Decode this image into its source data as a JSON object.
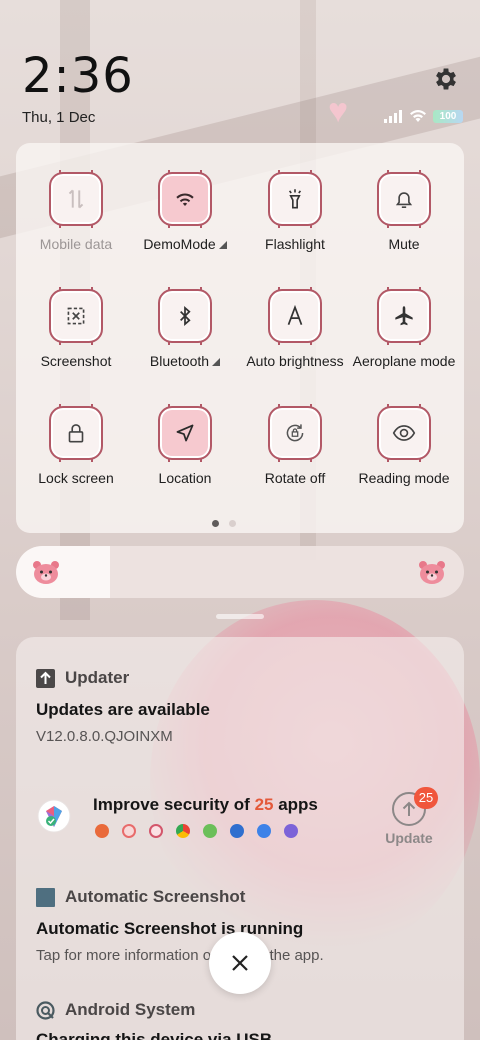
{
  "status": {
    "time": "2:36",
    "date": "Thu, 1 Dec",
    "battery_level": "100",
    "settings_icon": "gear-icon"
  },
  "quick_settings": {
    "tiles": [
      {
        "label": "Mobile data",
        "icon": "mobile-data-icon",
        "active": false,
        "disabled": true
      },
      {
        "label": "DemoMode",
        "icon": "wifi-icon",
        "active": true,
        "expandable": true
      },
      {
        "label": "Flashlight",
        "icon": "flashlight-icon",
        "active": false
      },
      {
        "label": "Mute",
        "icon": "bell-icon",
        "active": false
      },
      {
        "label": "Screenshot",
        "icon": "screenshot-icon",
        "active": false
      },
      {
        "label": "Bluetooth",
        "icon": "bluetooth-icon",
        "active": false,
        "expandable": true
      },
      {
        "label": "Auto brightness",
        "icon": "auto-brightness-icon",
        "active": false
      },
      {
        "label": "Aeroplane mode",
        "icon": "airplane-icon",
        "active": false
      },
      {
        "label": "Lock screen",
        "icon": "lock-icon",
        "active": false
      },
      {
        "label": "Location",
        "icon": "location-icon",
        "active": true
      },
      {
        "label": "Rotate off",
        "icon": "rotate-lock-icon",
        "active": false
      },
      {
        "label": "Reading mode",
        "icon": "eye-icon",
        "active": false
      }
    ],
    "page_indicator": {
      "current": 1,
      "total": 2
    }
  },
  "brightness": {
    "level": 0.21
  },
  "notifications": {
    "updater": {
      "app": "Updater",
      "title": "Updates are available",
      "text": "V12.0.8.0.QJOINXM"
    },
    "security": {
      "title_prefix": "Improve security of ",
      "count": "25",
      "title_suffix": " apps",
      "button_label": "Update",
      "badge": "25"
    },
    "screenshot": {
      "app": "Automatic Screenshot",
      "title": "Automatic Screenshot is running",
      "text": "Tap for more information or to stop the app."
    },
    "android": {
      "app": "Android System",
      "title": "Charging this device via USB"
    }
  },
  "colors": {
    "accent": "#b25866",
    "active_tile": "#f6c9cf",
    "badge": "#f0563c"
  }
}
